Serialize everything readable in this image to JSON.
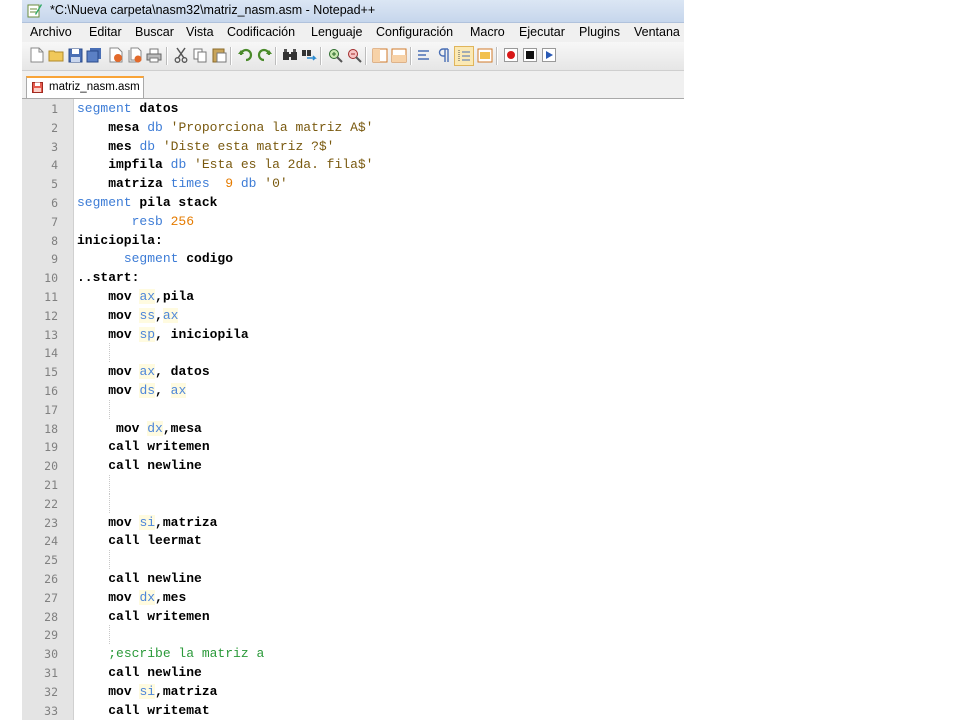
{
  "window": {
    "title": "*C:\\Nueva carpeta\\nasm32\\matriz_nasm.asm - Notepad++"
  },
  "menu": [
    "Archivo",
    "Editar",
    "Buscar",
    "Vista",
    "Codificación",
    "Lenguaje",
    "Configuración",
    "Macro",
    "Ejecutar",
    "Plugins",
    "Ventana"
  ],
  "tab": {
    "label": "matriz_nasm.asm"
  },
  "lines": [
    {
      "n": "1",
      "indent": "",
      "parts": [
        [
          "kw",
          "segment"
        ],
        [
          "t",
          " datos"
        ]
      ]
    },
    {
      "n": "2",
      "indent": "    ",
      "parts": [
        [
          "t",
          "mesa "
        ],
        [
          "kw",
          "db"
        ],
        [
          "s",
          " 'Proporciona la matriz A$'"
        ]
      ]
    },
    {
      "n": "3",
      "indent": "    ",
      "parts": [
        [
          "t",
          "mes "
        ],
        [
          "kw",
          "db"
        ],
        [
          "s",
          " 'Diste esta matriz ?$'"
        ]
      ]
    },
    {
      "n": "4",
      "indent": "    ",
      "parts": [
        [
          "t",
          "impfila "
        ],
        [
          "kw",
          "db"
        ],
        [
          "s",
          " 'Esta es la 2da. fila$'"
        ]
      ]
    },
    {
      "n": "5",
      "indent": "    ",
      "parts": [
        [
          "t",
          "matriza "
        ],
        [
          "kw",
          "times"
        ],
        [
          "num",
          "  9 "
        ],
        [
          "kw",
          "db"
        ],
        [
          "s",
          " '0'"
        ]
      ]
    },
    {
      "n": "6",
      "indent": "",
      "parts": [
        [
          "kw",
          "segment"
        ],
        [
          "t",
          " pila stack"
        ]
      ]
    },
    {
      "n": "7",
      "indent": "       ",
      "parts": [
        [
          "kw",
          "resb"
        ],
        [
          "num",
          " 256"
        ]
      ]
    },
    {
      "n": "8",
      "indent": "",
      "parts": [
        [
          "t",
          "iniciopila:"
        ]
      ]
    },
    {
      "n": "9",
      "indent": "      ",
      "parts": [
        [
          "kw",
          "segment"
        ],
        [
          "t",
          " codigo"
        ]
      ]
    },
    {
      "n": "10",
      "indent": "",
      "parts": [
        [
          "t",
          "..start:"
        ]
      ]
    },
    {
      "n": "11",
      "indent": "    ",
      "parts": [
        [
          "t",
          "mov "
        ],
        [
          "r",
          "ax"
        ],
        [
          "t",
          ",pila"
        ]
      ]
    },
    {
      "n": "12",
      "indent": "    ",
      "parts": [
        [
          "t",
          "mov "
        ],
        [
          "r",
          "ss"
        ],
        [
          "t",
          ","
        ],
        [
          "r",
          "ax"
        ]
      ]
    },
    {
      "n": "13",
      "indent": "    ",
      "parts": [
        [
          "t",
          "mov "
        ],
        [
          "r",
          "sp"
        ],
        [
          "t",
          ", iniciopila"
        ]
      ]
    },
    {
      "n": "14",
      "indent": "",
      "parts": []
    },
    {
      "n": "15",
      "indent": "    ",
      "parts": [
        [
          "t",
          "mov "
        ],
        [
          "r",
          "ax"
        ],
        [
          "t",
          ", datos"
        ]
      ]
    },
    {
      "n": "16",
      "indent": "    ",
      "parts": [
        [
          "t",
          "mov "
        ],
        [
          "r",
          "ds"
        ],
        [
          "t",
          ", "
        ],
        [
          "r",
          "ax"
        ]
      ]
    },
    {
      "n": "17",
      "indent": "",
      "parts": []
    },
    {
      "n": "18",
      "indent": "     ",
      "parts": [
        [
          "t",
          "mov "
        ],
        [
          "r",
          "dx"
        ],
        [
          "t",
          ",mesa"
        ]
      ]
    },
    {
      "n": "19",
      "indent": "    ",
      "parts": [
        [
          "t",
          "call writemen"
        ]
      ]
    },
    {
      "n": "20",
      "indent": "    ",
      "parts": [
        [
          "t",
          "call newline"
        ]
      ]
    },
    {
      "n": "21",
      "indent": "",
      "parts": []
    },
    {
      "n": "22",
      "indent": "",
      "parts": []
    },
    {
      "n": "23",
      "indent": "    ",
      "parts": [
        [
          "t",
          "mov "
        ],
        [
          "r",
          "si"
        ],
        [
          "t",
          ",matriza"
        ]
      ]
    },
    {
      "n": "24",
      "indent": "    ",
      "parts": [
        [
          "t",
          "call leermat"
        ]
      ]
    },
    {
      "n": "25",
      "indent": "",
      "parts": []
    },
    {
      "n": "26",
      "indent": "    ",
      "parts": [
        [
          "t",
          "call newline"
        ]
      ]
    },
    {
      "n": "27",
      "indent": "    ",
      "parts": [
        [
          "t",
          "mov "
        ],
        [
          "r",
          "dx"
        ],
        [
          "t",
          ",mes"
        ]
      ]
    },
    {
      "n": "28",
      "indent": "    ",
      "parts": [
        [
          "t",
          "call writemen"
        ]
      ]
    },
    {
      "n": "29",
      "indent": "",
      "parts": []
    },
    {
      "n": "30",
      "indent": "    ",
      "parts": [
        [
          "c",
          ";escribe la matriz a"
        ]
      ]
    },
    {
      "n": "31",
      "indent": "    ",
      "parts": [
        [
          "t",
          "call newline"
        ]
      ]
    },
    {
      "n": "32",
      "indent": "    ",
      "parts": [
        [
          "t",
          "mov "
        ],
        [
          "r",
          "si"
        ],
        [
          "t",
          ",matriza"
        ]
      ]
    },
    {
      "n": "33",
      "indent": "    ",
      "parts": [
        [
          "t",
          "call writemat"
        ]
      ]
    }
  ],
  "icons": [
    "notepad-icon",
    "new-file-icon",
    "open-file-icon",
    "save-icon",
    "save-all-icon",
    "close-icon",
    "close-all-icon",
    "print-icon",
    "cut-icon",
    "copy-icon",
    "paste-icon",
    "undo-icon",
    "redo-icon",
    "find-icon",
    "replace-icon",
    "zoom-in-icon",
    "zoom-out-icon",
    "sync-v-icon",
    "sync-h-icon",
    "word-wrap-icon",
    "show-all-chars-icon",
    "indent-guide-icon",
    "udl-icon",
    "record-macro-icon",
    "stop-record-icon",
    "play-macro-icon"
  ],
  "colors": {
    "keyword": "#3d7cd6",
    "string": "#7a5a10",
    "number": "#e57b00",
    "comment": "#2b9a3a",
    "tab_accent": "#f9a438"
  }
}
